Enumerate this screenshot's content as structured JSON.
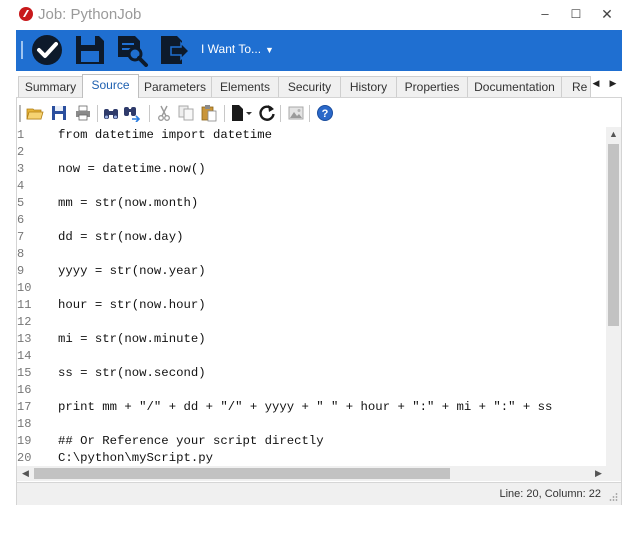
{
  "window": {
    "title": "Job: PythonJob",
    "controls": {
      "minimize": "–",
      "maximize": "☐",
      "close": "✕"
    }
  },
  "ribbon": {
    "background": "#1f6fd1",
    "buttons": [
      {
        "name": "ok-check-icon"
      },
      {
        "name": "save-disk-icon"
      },
      {
        "name": "preview-magnifier-icon"
      },
      {
        "name": "export-document-icon"
      }
    ],
    "menu_label": "I Want To..."
  },
  "tabs": {
    "items": [
      {
        "label": "Summary"
      },
      {
        "label": "Source"
      },
      {
        "label": "Parameters"
      },
      {
        "label": "Elements"
      },
      {
        "label": "Security"
      },
      {
        "label": "History"
      },
      {
        "label": "Properties"
      },
      {
        "label": "Documentation"
      },
      {
        "label": "Re"
      }
    ],
    "active": "Source",
    "scroll_left": "◀",
    "scroll_right": "▶"
  },
  "editor_toolbar": {
    "icons": [
      "open-folder-icon",
      "save-icon",
      "print-icon",
      "find-binoculars-icon",
      "find-replace-icon",
      "cut-icon",
      "copy-icon",
      "paste-icon",
      "new-document-icon",
      "refresh-icon",
      "image-icon",
      "help-icon"
    ]
  },
  "editor": {
    "lines": [
      {
        "num": "1",
        "code": "from datetime import datetime"
      },
      {
        "num": "2",
        "code": ""
      },
      {
        "num": "3",
        "code": "now = datetime.now()"
      },
      {
        "num": "4",
        "code": ""
      },
      {
        "num": "5",
        "code": "mm = str(now.month)"
      },
      {
        "num": "6",
        "code": ""
      },
      {
        "num": "7",
        "code": "dd = str(now.day)"
      },
      {
        "num": "8",
        "code": ""
      },
      {
        "num": "9",
        "code": "yyyy = str(now.year)"
      },
      {
        "num": "10",
        "code": ""
      },
      {
        "num": "11",
        "code": "hour = str(now.hour)"
      },
      {
        "num": "12",
        "code": ""
      },
      {
        "num": "13",
        "code": "mi = str(now.minute)"
      },
      {
        "num": "14",
        "code": ""
      },
      {
        "num": "15",
        "code": "ss = str(now.second)"
      },
      {
        "num": "16",
        "code": ""
      },
      {
        "num": "17",
        "code": "print mm + \"/\" + dd + \"/\" + yyyy + \" \" + hour + \":\" + mi + \":\" + ss"
      },
      {
        "num": "18",
        "code": ""
      },
      {
        "num": "19",
        "code": "## Or Reference your script directly"
      },
      {
        "num": "20",
        "code": "C:\\python\\myScript.py"
      }
    ]
  },
  "scrollbars": {
    "up": "▲",
    "down": "▼",
    "left": "◀",
    "right": "▶"
  },
  "status": {
    "position": "Line: 20, Column: 22"
  }
}
